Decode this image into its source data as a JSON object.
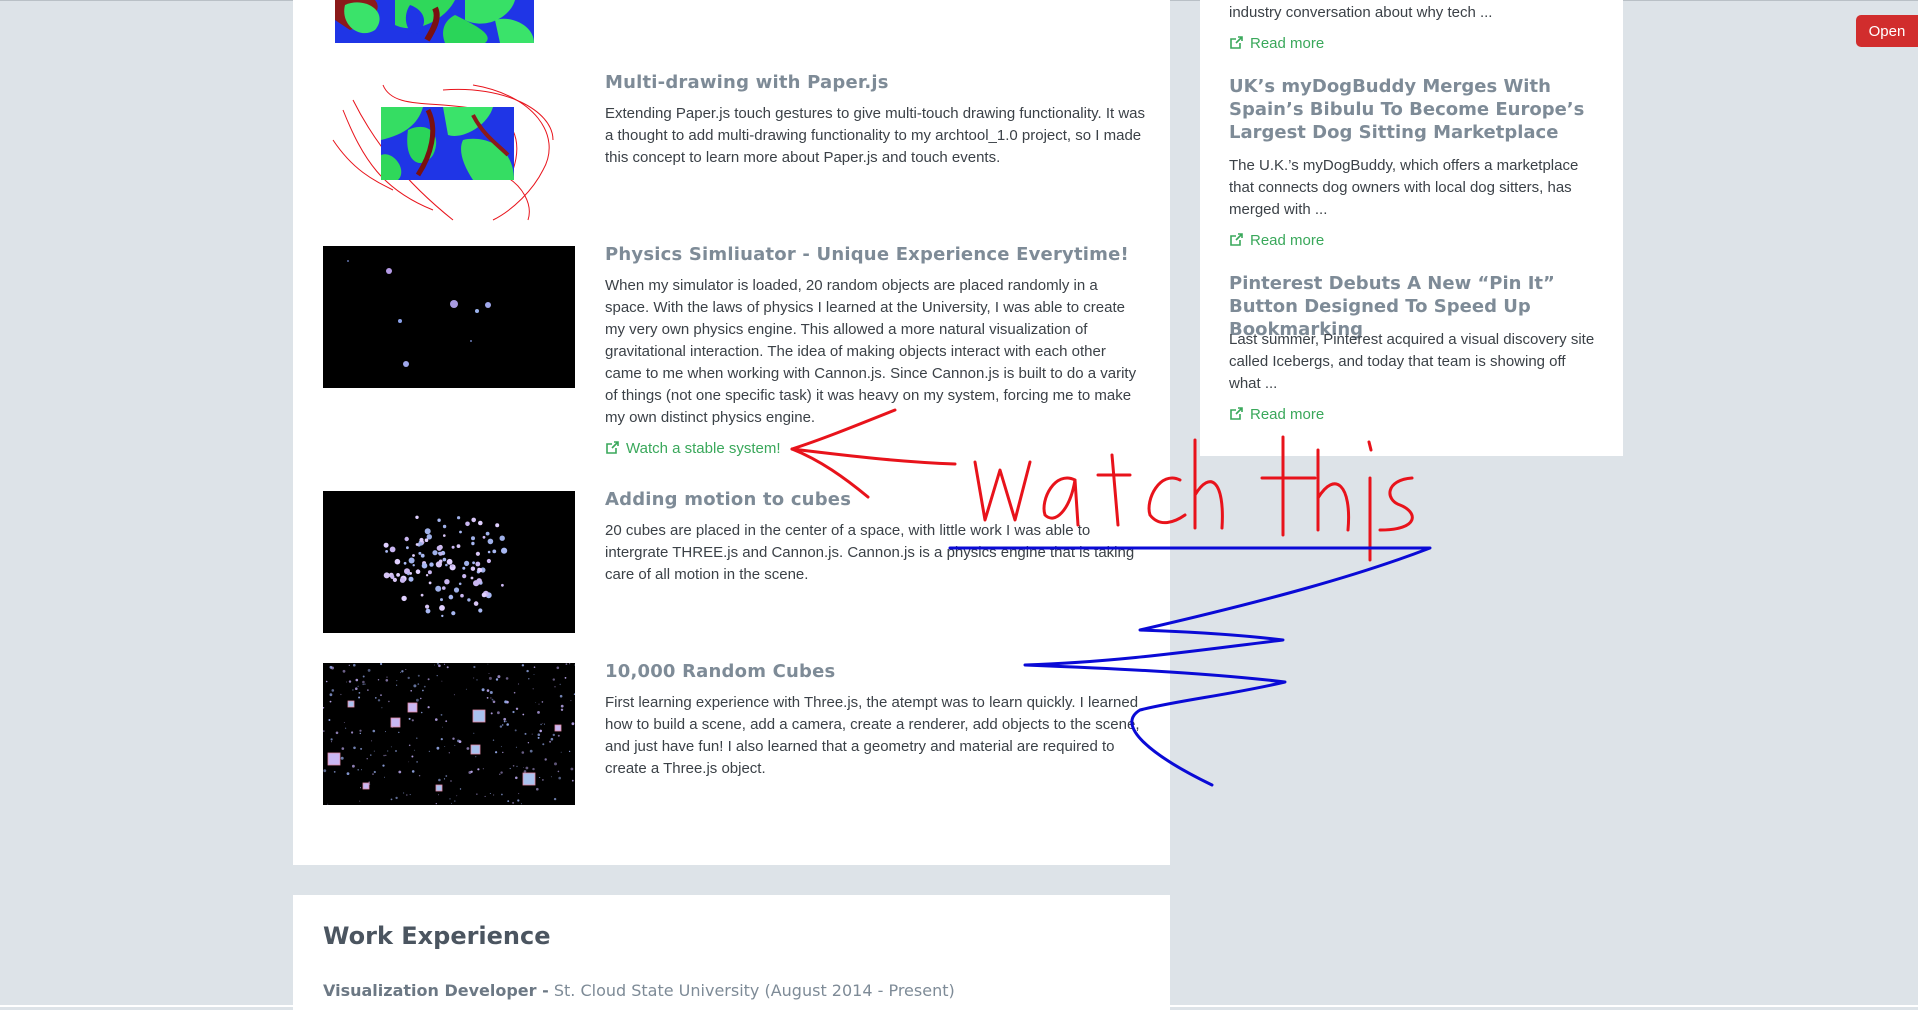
{
  "projects": [
    {
      "title": "Multi-drawing with Paper.js",
      "description": "Extending Paper.js touch gestures to give multi-touch drawing functionality. It was a thought to add multi-drawing functionality to my archtool_1.0 project, so I made this concept to learn more about Paper.js and touch events."
    },
    {
      "title": "Physics Simliuator - Unique Experience Everytime!",
      "description": "When my simulator is loaded, 20 random objects are placed randomly in a space. With the laws of physics I learned at the University, I was able to create my very own physics engine. This allowed a more natural visualization of gravitational interaction. The idea of making objects interact with each other came to me when working with Cannon.js. Since Cannon.js is built to do a varity of things (not one specific task) it was heavy on my system, forcing me to make my own distinct physics engine.",
      "link": "Watch a stable system!"
    },
    {
      "title": "Adding motion to cubes",
      "description": "20 cubes are placed in the center of a space, with little work I was able to intergrate THREE.js and Cannon.js. Cannon.js is a physics engine that is taking care of all motion in the scene."
    },
    {
      "title": "10,000 Random Cubes",
      "description": "First learning experience with Three.js, the atempt was to learn quickly. I learned how to build a scene, add a camera, create a renderer, add objects to the scene, and just have fun! I also learned that a geometry and material are required to create a Three.js object."
    }
  ],
  "news": {
    "partial_desc": "industry conversation about why tech ...",
    "items": [
      {
        "title": "UK’s myDogBuddy Merges With Spain’s Bibulu To Become Europe’s Largest Dog Sitting Marketplace",
        "description": " The U.K.’s myDogBuddy, which offers a marketplace that connects dog owners with local dog sitters, has merged with ..."
      },
      {
        "title": "Pinterest Debuts A New “Pin It” Button Designed To Speed Up Bookmarking",
        "description": " Last summer, Pinterest acquired a visual discovery site called Icebergs, and today that team is showing off what ..."
      }
    ],
    "read_more_label": "Read more"
  },
  "open_button": "Open",
  "work_experience": {
    "heading": "Work Experience",
    "job_title": "Visualization Developer -",
    "job_place": " St. Cloud State University (August 2014 - Present)"
  },
  "annotation": {
    "text": "watch this"
  },
  "colors": {
    "background": "#dde3e8",
    "card": "#ffffff",
    "title": "#7e8b97",
    "link": "#3aa85b",
    "open_button": "#d12d2d",
    "red_ink": "#e8131b",
    "blue_ink": "#0a0ad6"
  }
}
